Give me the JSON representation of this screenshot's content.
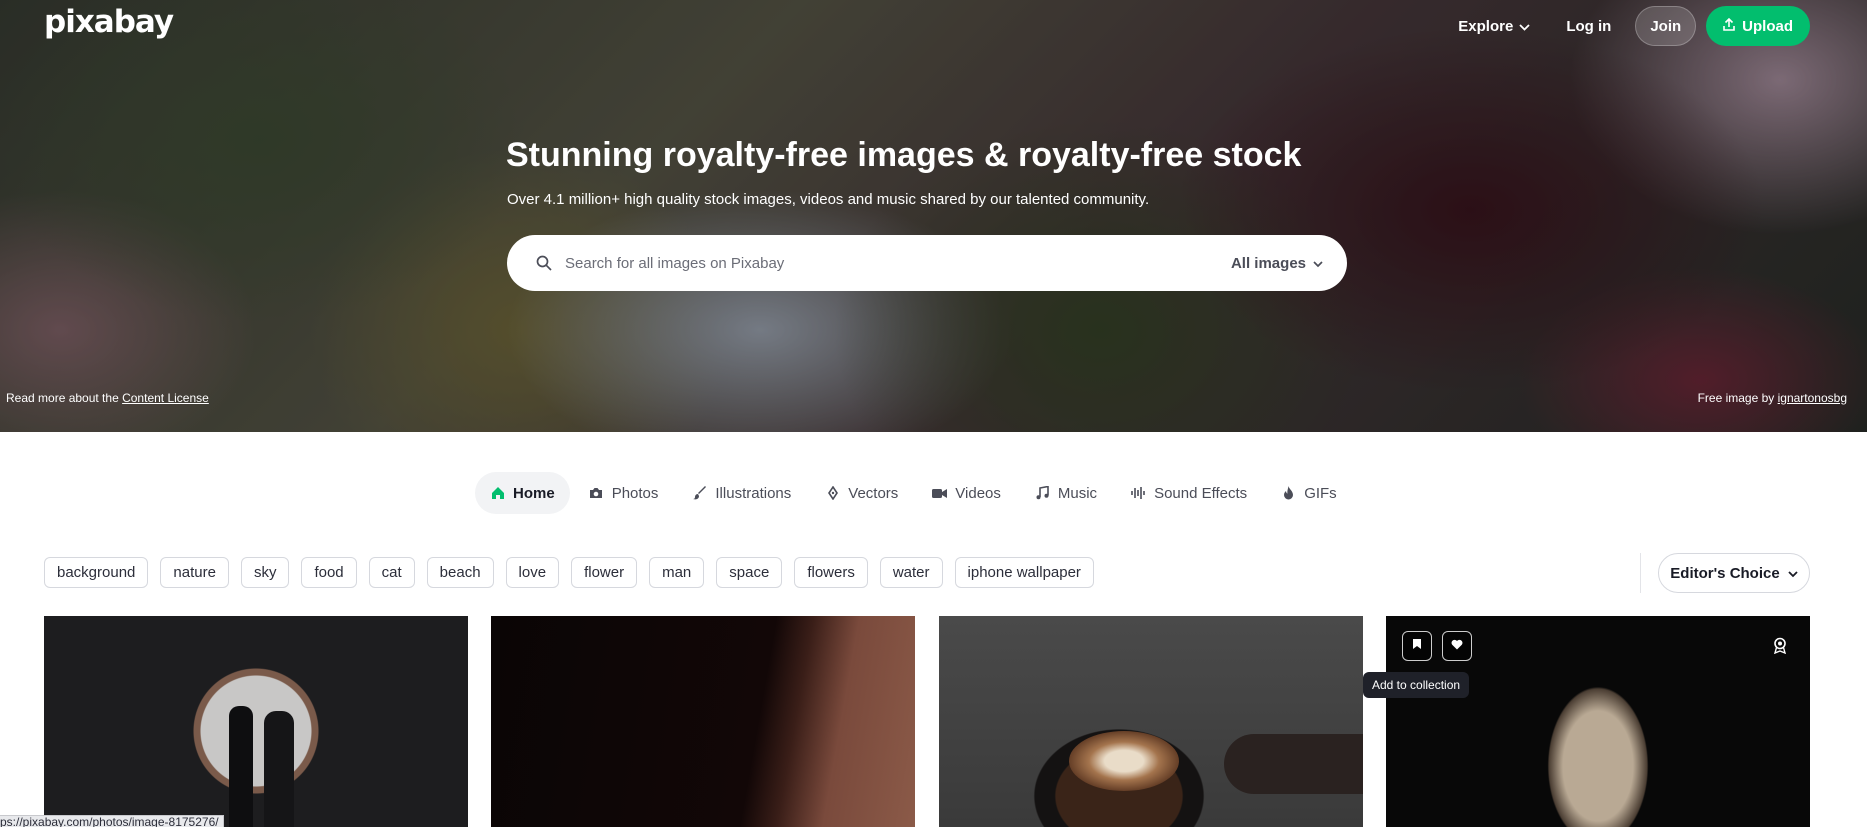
{
  "header": {
    "logo": "pixabay",
    "nav": {
      "explore": "Explore",
      "login": "Log in",
      "join": "Join",
      "upload": "Upload"
    }
  },
  "hero": {
    "title": "Stunning royalty-free images & royalty-free stock",
    "subtitle": "Over 4.1 million+ high quality stock images, videos and music shared by our talented community.",
    "search": {
      "placeholder": "Search for all images on Pixabay",
      "value": "",
      "type_selector": "All images"
    },
    "license_prefix": "Read more about the",
    "license_link": "Content License",
    "credit_prefix": "Free image by",
    "credit_author": "ignartonosbg"
  },
  "tabs": [
    {
      "label": "Home",
      "icon": "home-icon",
      "active": true
    },
    {
      "label": "Photos",
      "icon": "camera-icon"
    },
    {
      "label": "Illustrations",
      "icon": "brush-icon"
    },
    {
      "label": "Vectors",
      "icon": "pen-nib-icon"
    },
    {
      "label": "Videos",
      "icon": "video-icon"
    },
    {
      "label": "Music",
      "icon": "music-note-icon"
    },
    {
      "label": "Sound Effects",
      "icon": "sound-wave-icon"
    },
    {
      "label": "GIFs",
      "icon": "flame-icon"
    }
  ],
  "tags": [
    "background",
    "nature",
    "sky",
    "food",
    "cat",
    "beach",
    "love",
    "flower",
    "man",
    "space",
    "flowers",
    "water",
    "iphone wallpaper"
  ],
  "sort": {
    "label": "Editor's Choice"
  },
  "grid": {
    "tooltip": "Add to collection"
  },
  "status_url": "ps://pixabay.com/photos/image-8175276/",
  "colors": {
    "accent": "#02be6e",
    "text": "#191b26",
    "tooltip_bg": "#1f2129"
  }
}
